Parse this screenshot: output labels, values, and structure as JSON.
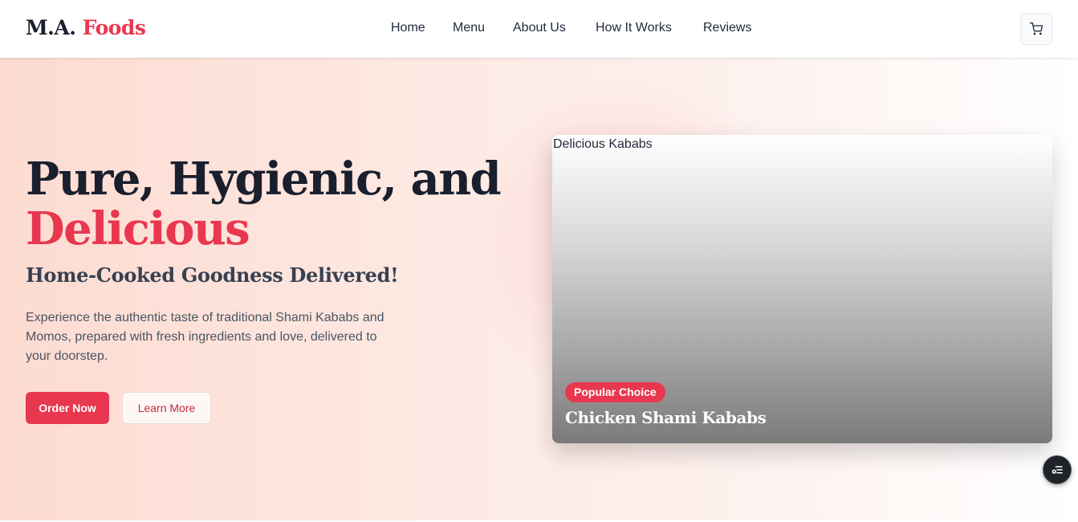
{
  "header": {
    "brand_main": "M.A.",
    "brand_accent": "Foods",
    "nav": [
      {
        "label": "Home"
      },
      {
        "label": "Menu"
      },
      {
        "label": "About Us"
      },
      {
        "label": "How It Works"
      },
      {
        "label": "Reviews"
      }
    ],
    "cart_icon": "shopping-cart-icon"
  },
  "hero": {
    "title_line1": "Pure, Hygienic, and",
    "title_line2": "Delicious",
    "subtitle": "Home-Cooked Goodness Delivered!",
    "description": "Experience the authentic taste of traditional Shami Kababs and Momos, prepared with fresh ingredients and love, delivered to your doorstep.",
    "primary_button": "Order Now",
    "secondary_button": "Learn More",
    "image_alt": "Delicious Kababs",
    "badge": "Popular Choice",
    "card_title": "Chicken Shami Kababs"
  },
  "floating_button": {
    "icon": "task-list-icon"
  },
  "colors": {
    "accent": "#e8374f",
    "text_dark": "#1a1f2e",
    "hero_bg_start": "#fddbd1",
    "hero_bg_end": "#ffffff"
  }
}
